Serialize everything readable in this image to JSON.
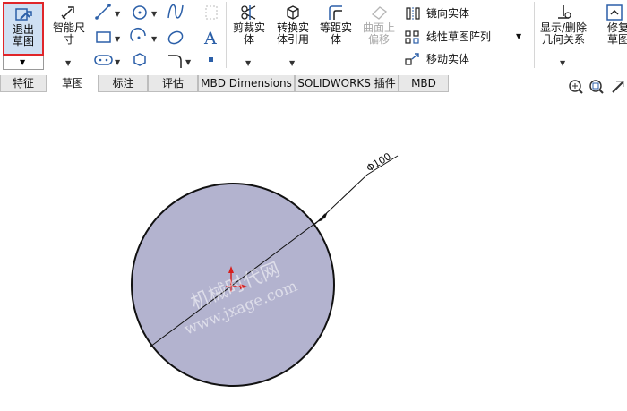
{
  "ribbon": {
    "exit_sketch": "退出草图",
    "smart_dimension": "智能尺寸",
    "trim": "剪裁实体",
    "convert": "转换实体引用",
    "offset": "等距实体",
    "surface_offset": "曲面上偏移",
    "mirror": "镜向实体",
    "linear_pattern": "线性草图阵列",
    "move": "移动实体",
    "display_relations": "显示/删除几何关系",
    "repair": "修复草图"
  },
  "tabs": [
    "特征",
    "草图",
    "标注",
    "评估",
    "MBD Dimensions",
    "SOLIDWORKS 插件",
    "MBD"
  ],
  "active_tab": "草图",
  "canvas": {
    "dimension_label": "Φ100",
    "watermark_cn": "机械时代网",
    "watermark_url": "www.jxage.com"
  },
  "colors": {
    "circle_fill": "#b3b3cf",
    "highlight": "#e0262a",
    "origin": "#d61e1e"
  }
}
